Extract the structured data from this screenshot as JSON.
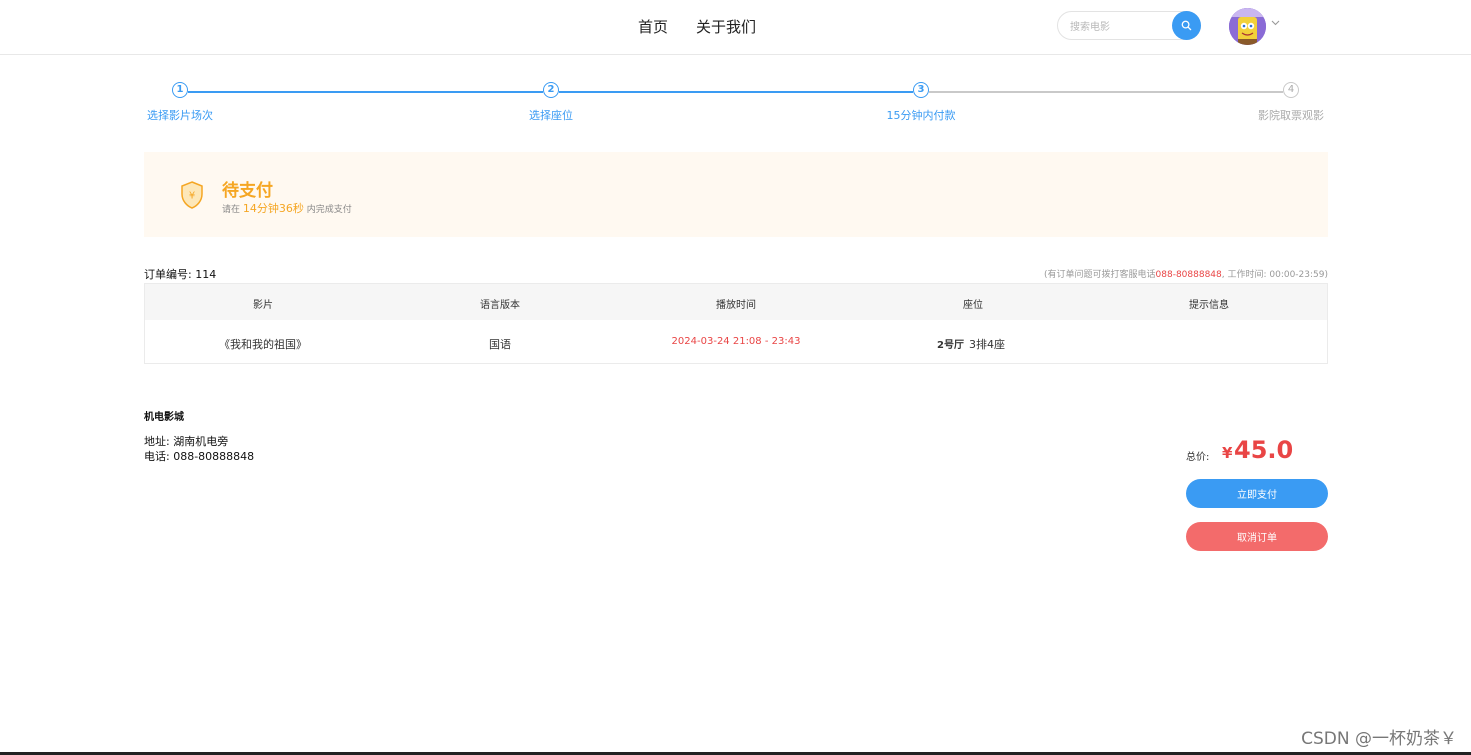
{
  "header": {
    "nav": [
      "首页",
      "关于我们"
    ],
    "search_placeholder": "搜索电影"
  },
  "steps": [
    {
      "num": "1",
      "label": "选择影片场次",
      "active": true
    },
    {
      "num": "2",
      "label": "选择座位",
      "active": true
    },
    {
      "num": "3",
      "label": "15分钟内付款",
      "active": true
    },
    {
      "num": "4",
      "label": "影院取票观影",
      "active": false
    }
  ],
  "banner": {
    "title": "待支付",
    "prefix": "请在",
    "countdown": "14分钟36秒",
    "suffix": "内完成支付"
  },
  "order": {
    "number_label": "订单编号:",
    "number": "114",
    "hotline_prefix": "(有订单问题可拨打客服电话",
    "hotline_phone": "088-80888848",
    "hotline_suffix": ", 工作时间: 00:00-23:59)"
  },
  "table": {
    "headers": [
      "影片",
      "语言版本",
      "播放时间",
      "座位",
      "提示信息"
    ],
    "row": {
      "movie": "《我和我的祖国》",
      "language": "国语",
      "time": "2024-03-24 21:08 - 23:43",
      "hall": "2号厅",
      "seat": "3排4座",
      "tip": ""
    }
  },
  "cinema": {
    "name": "机电影城",
    "address": "地址: 湖南机电旁",
    "phone": "电话: 088-80888848"
  },
  "price": {
    "label": "总价:",
    "currency": "¥",
    "value": "45.0"
  },
  "buttons": {
    "pay": "立即支付",
    "cancel": "取消订单"
  },
  "watermark": "CSDN @一杯奶茶￥",
  "colors": {
    "primary": "#3a9bf3",
    "warning": "#f5a623",
    "danger": "#e94545",
    "cancel": "#f36b6b"
  }
}
